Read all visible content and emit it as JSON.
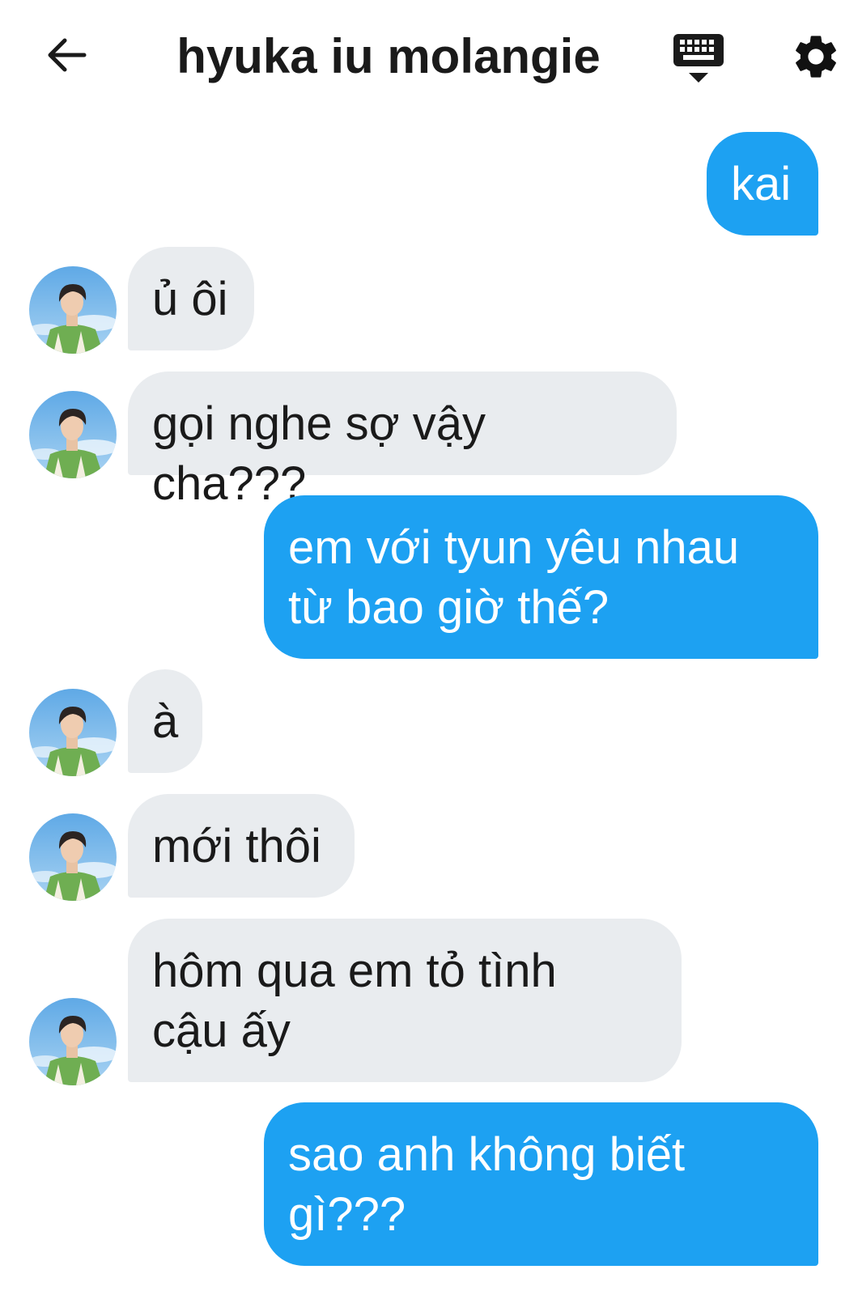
{
  "header": {
    "title": "hyuka iu molangie",
    "back_icon": "arrow-left-icon",
    "keyboard_icon": "keyboard-icon",
    "settings_icon": "gear-icon"
  },
  "colors": {
    "outgoing_bubble": "#1da1f2",
    "incoming_bubble": "#e9ecef"
  },
  "messages": [
    {
      "side": "out",
      "text": "kai"
    },
    {
      "side": "in",
      "text": "ủ ôi"
    },
    {
      "side": "in",
      "text": "gọi nghe sợ vậy cha???"
    },
    {
      "side": "out",
      "text": "em với tyun yêu nhau\ntừ bao giờ thế?"
    },
    {
      "side": "in",
      "text": "à"
    },
    {
      "side": "in",
      "text": "mới thôi"
    },
    {
      "side": "in",
      "text": "hôm qua em tỏ tình\ncậu ấy"
    },
    {
      "side": "out",
      "text": "sao anh không biết\ngì???"
    }
  ]
}
